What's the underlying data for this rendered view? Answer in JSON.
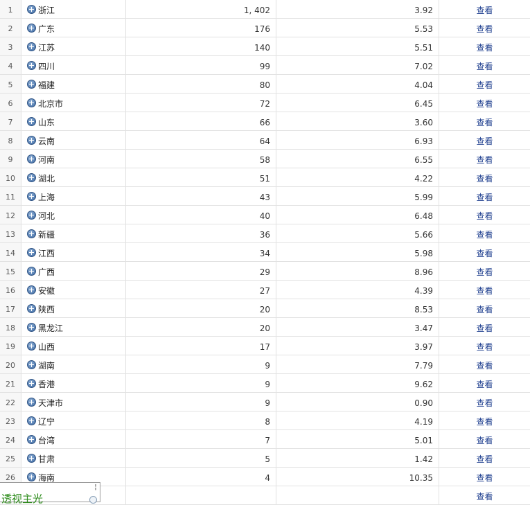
{
  "rows": [
    {
      "idx": "1",
      "name": "浙江",
      "count": "1, 402",
      "avg": "3.92",
      "action": "查看"
    },
    {
      "idx": "2",
      "name": "广东",
      "count": "176",
      "avg": "5.53",
      "action": "查看"
    },
    {
      "idx": "3",
      "name": "江苏",
      "count": "140",
      "avg": "5.51",
      "action": "查看"
    },
    {
      "idx": "4",
      "name": "四川",
      "count": "99",
      "avg": "7.02",
      "action": "查看"
    },
    {
      "idx": "5",
      "name": "福建",
      "count": "80",
      "avg": "4.04",
      "action": "查看"
    },
    {
      "idx": "6",
      "name": "北京市",
      "count": "72",
      "avg": "6.45",
      "action": "查看"
    },
    {
      "idx": "7",
      "name": "山东",
      "count": "66",
      "avg": "3.60",
      "action": "查看"
    },
    {
      "idx": "8",
      "name": "云南",
      "count": "64",
      "avg": "6.93",
      "action": "查看"
    },
    {
      "idx": "9",
      "name": "河南",
      "count": "58",
      "avg": "6.55",
      "action": "查看"
    },
    {
      "idx": "10",
      "name": "湖北",
      "count": "51",
      "avg": "4.22",
      "action": "查看"
    },
    {
      "idx": "11",
      "name": "上海",
      "count": "43",
      "avg": "5.99",
      "action": "查看"
    },
    {
      "idx": "12",
      "name": "河北",
      "count": "40",
      "avg": "6.48",
      "action": "查看"
    },
    {
      "idx": "13",
      "name": "新疆",
      "count": "36",
      "avg": "5.66",
      "action": "查看"
    },
    {
      "idx": "14",
      "name": "江西",
      "count": "34",
      "avg": "5.98",
      "action": "查看"
    },
    {
      "idx": "15",
      "name": "广西",
      "count": "29",
      "avg": "8.96",
      "action": "查看"
    },
    {
      "idx": "16",
      "name": "安徽",
      "count": "27",
      "avg": "4.39",
      "action": "查看"
    },
    {
      "idx": "17",
      "name": "陕西",
      "count": "20",
      "avg": "8.53",
      "action": "查看"
    },
    {
      "idx": "18",
      "name": "黑龙江",
      "count": "20",
      "avg": "3.47",
      "action": "查看"
    },
    {
      "idx": "19",
      "name": "山西",
      "count": "17",
      "avg": "3.97",
      "action": "查看"
    },
    {
      "idx": "20",
      "name": "湖南",
      "count": "9",
      "avg": "7.79",
      "action": "查看"
    },
    {
      "idx": "21",
      "name": "香港",
      "count": "9",
      "avg": "9.62",
      "action": "查看"
    },
    {
      "idx": "22",
      "name": "天津市",
      "count": "9",
      "avg": "0.90",
      "action": "查看"
    },
    {
      "idx": "23",
      "name": "辽宁",
      "count": "8",
      "avg": "4.19",
      "action": "查看"
    },
    {
      "idx": "24",
      "name": "台湾",
      "count": "7",
      "avg": "5.01",
      "action": "查看"
    },
    {
      "idx": "25",
      "name": "甘肃",
      "count": "5",
      "avg": "1.42",
      "action": "查看"
    },
    {
      "idx": "26",
      "name": "海南",
      "count": "4",
      "avg": "10.35",
      "action": "查看"
    },
    {
      "idx": "",
      "name": "",
      "count": "",
      "avg": "",
      "action": "查看"
    }
  ],
  "icons": {
    "expand": "plus-circle-icon"
  },
  "colors": {
    "link": "#1f3f8f",
    "popup_title": "#2a8a18",
    "row_border": "#e2e2e2"
  },
  "popup": {
    "title": "透视主光",
    "handle": "¦"
  }
}
